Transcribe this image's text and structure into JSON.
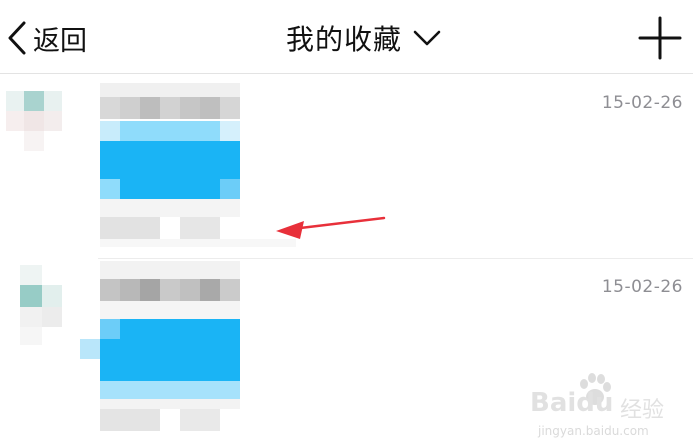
{
  "nav": {
    "back_label": "返回",
    "title": "我的收藏",
    "back_icon": "chevron-left-icon",
    "title_icon": "chevron-down-icon",
    "add_icon": "plus-icon"
  },
  "items": [
    {
      "date": "15-02-26"
    },
    {
      "date": "15-02-26"
    }
  ],
  "watermark": {
    "brand": "Baidu",
    "cn": "经验",
    "url": "jingyan.baidu.com"
  },
  "colors": {
    "accent_blue": "#1ab4f5",
    "annotation_red": "#e8303a",
    "text_secondary": "#8e8e93"
  }
}
